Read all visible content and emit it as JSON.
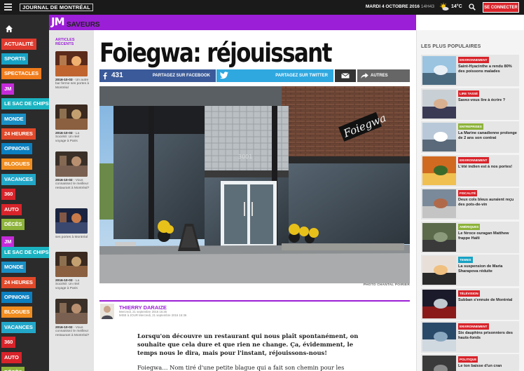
{
  "header": {
    "logo_text": "JOURNAL DE MONTRÉAL",
    "date": "MARDI 4 OCTOBRE 2016",
    "time": "14H43",
    "temperature": "14°C",
    "connect_label": "SE CONNECTER",
    "weather_icon": "sun-cloud-icon"
  },
  "nav": {
    "items": [
      {
        "label": "ACTUALITÉ",
        "color": "#e03a2e"
      },
      {
        "label": "SPORTS",
        "color": "#17a2c4"
      },
      {
        "label": "SPECTACLES",
        "color": "#f07c1c"
      },
      {
        "label": "JM",
        "color": "#c42bd8"
      },
      {
        "label": "LE SAC DE CHIPS",
        "color": "#1bb3c1"
      },
      {
        "label": "MONDE",
        "color": "#1a8fc4"
      },
      {
        "label": "24 HEURES",
        "color": "#e0492a"
      },
      {
        "label": "OPINIONS",
        "color": "#0b7fbf"
      },
      {
        "label": "BLOGUES",
        "color": "#f08d1f"
      },
      {
        "label": "VACANCES",
        "color": "#22a7c9"
      },
      {
        "label": "360",
        "color": "#d8232a"
      },
      {
        "label": "AUTO",
        "color": "#d8232a"
      },
      {
        "label": "DÉCÈS",
        "color": "#8db33a"
      },
      {
        "label": "JM",
        "color": "#c42bd8"
      },
      {
        "label": "LE SAC DE CHIPS",
        "color": "#1bb3c1"
      },
      {
        "label": "MONDE",
        "color": "#1a8fc4"
      },
      {
        "label": "24 HEURES",
        "color": "#e0492a"
      },
      {
        "label": "OPINIONS",
        "color": "#0b7fbf"
      },
      {
        "label": "BLOGUES",
        "color": "#f08d1f"
      },
      {
        "label": "VACANCES",
        "color": "#22a7c9"
      },
      {
        "label": "360",
        "color": "#d8232a"
      },
      {
        "label": "AUTO",
        "color": "#d8232a"
      },
      {
        "label": "DÉCÈS",
        "color": "#8db33a"
      }
    ]
  },
  "section": {
    "logo": "JM",
    "name": "SAVEURS"
  },
  "articles": {
    "title": "ARTICLES RÉCENTS",
    "items": [
      {
        "date": "2016-10-03",
        "text": " - Un autre bar ferme ses portes à Montréal"
      },
      {
        "date": "2016-10-03",
        "text": " - La Société: Un réel voyage à Paris"
      },
      {
        "date": "2016-10-02",
        "text": " - Vous connaissez le meilleur restaurant à Montréal?"
      },
      {
        "date": "",
        "text": "ses portes à Montréal"
      },
      {
        "date": "2016-10-03",
        "text": " - La Société: Un réel voyage à Paris"
      },
      {
        "date": "2016-10-02",
        "text": " - Vous connaissez le meilleur restaurant à Montréal?"
      }
    ]
  },
  "article": {
    "headline": "Foiegwa: réjouissant",
    "share_count": "431",
    "share_facebook": "PARTAGEZ SUR FACEBOOK",
    "share_twitter": "PARTAGEZ SUR TWITTER",
    "share_more": "AUTRES",
    "photo_credit": "PHOTO CHANTAL POIRIER",
    "photo_sign": "Foiegwa",
    "photo_number": "3001",
    "author": "THIERRY DARAIZE",
    "date_line1": "Mercredi, 21 septembre 2016 16:36",
    "date_line2": "MISE à JOUR Mercredi, 21 septembre 2016 16:36",
    "lede": "Lorsqu'on découvre un restaurant qui nous plaît spontanément, on souhaite que cela dure et que rien ne change. Ça, évidemment, le temps nous le dira, mais pour l'instant, réjouissons-nous!",
    "body": "Foiegwa… Nom tiré d'une petite blague qui a fait son chemin pour les"
  },
  "popular": {
    "title": "LES PLUS POPULAIRES",
    "items": [
      {
        "category": "ENVIRONNEMENT",
        "cat_color": "#d8232a",
        "title": "Saint-Hyacinthe a rendu 80% des poissons malades"
      },
      {
        "category": "LIRE TASSÉ",
        "cat_color": "#d8232a",
        "title": "Savez-vous lire à écrire ?"
      },
      {
        "category": "ENTREPRISES",
        "cat_color": "#8db33a",
        "title": "La Marine canadienne prolonge de 2 ans son contrat"
      },
      {
        "category": "ENVIRONNEMENT",
        "cat_color": "#d8232a",
        "title": "L'été indien est à nos portes!"
      },
      {
        "category": "FISCALITÉ",
        "cat_color": "#d8232a",
        "title": "Deux cols bleus auraient reçu des pots-de-vin"
      },
      {
        "category": "AMÉRIQUES",
        "cat_color": "#8db33a",
        "title": "Le féroce ouragan Matthew frappe Haïti"
      },
      {
        "category": "TENNIS",
        "cat_color": "#17a2c4",
        "title": "La suspension de Maria Sharapova réduite"
      },
      {
        "category": "TÉLÉVISION",
        "cat_color": "#d8232a",
        "title": "Subban s'ennuie de Montréal"
      },
      {
        "category": "ENVIRONNEMENT",
        "cat_color": "#d8232a",
        "title": "Six dauphins prisonniers des hauts-fonds"
      },
      {
        "category": "POLITIQUE",
        "cat_color": "#d8232a",
        "title": "Le ton baisse d'un cran"
      }
    ]
  }
}
